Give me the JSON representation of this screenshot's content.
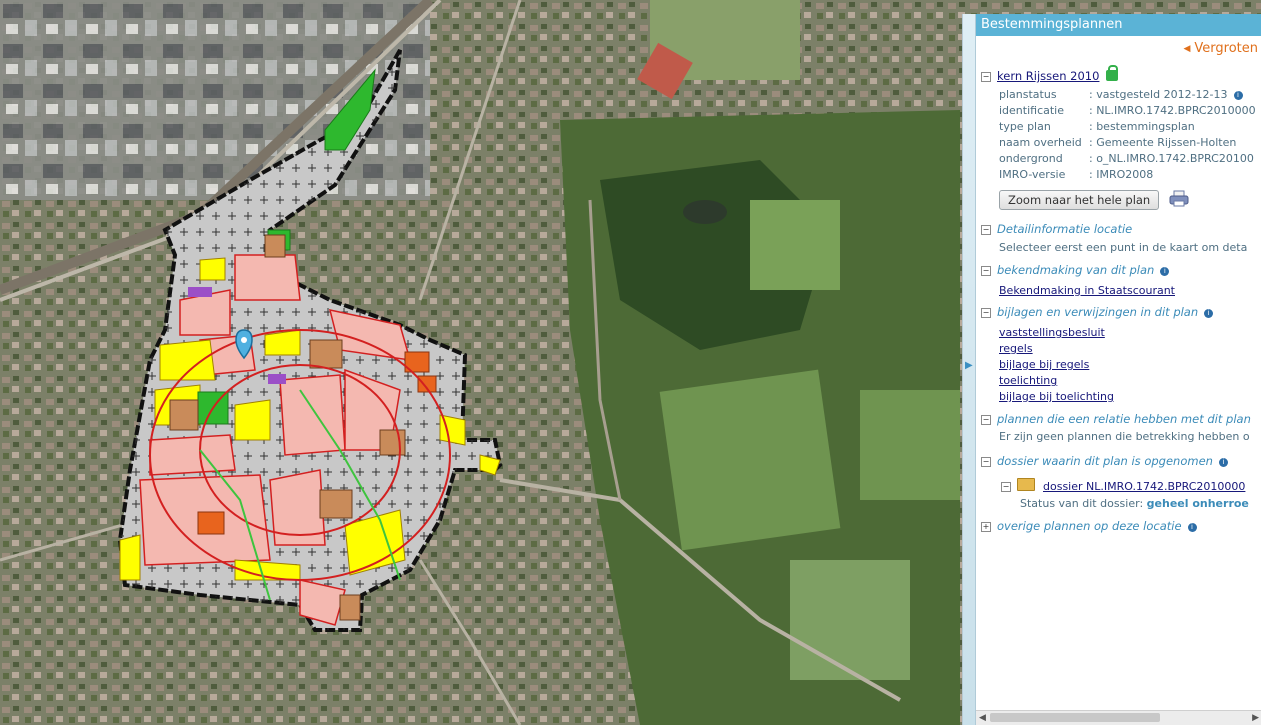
{
  "panel": {
    "title": "Bestemmingsplannen",
    "vergroten_label": "Vergroten",
    "plan": {
      "name": "kern Rijssen 2010",
      "fields": [
        {
          "key": "planstatus",
          "value": ": vastgesteld 2012-12-13"
        },
        {
          "key": "identificatie",
          "value": ": NL.IMRO.1742.BPRC2010000"
        },
        {
          "key": "type plan",
          "value": ": bestemmingsplan"
        },
        {
          "key": "naam overheid",
          "value": ": Gemeente Rijssen-Holten"
        },
        {
          "key": "ondergrond",
          "value": ": o_NL.IMRO.1742.BPRC20100"
        },
        {
          "key": "IMRO-versie",
          "value": ": IMRO2008"
        }
      ],
      "zoom_button": "Zoom naar het hele plan"
    },
    "detail": {
      "title": "Detailinformatie locatie",
      "text": "Selecteer eerst een punt in de kaart om deta"
    },
    "bekendmaking": {
      "title": "bekendmaking van dit plan",
      "link": "Bekendmaking in Staatscourant"
    },
    "bijlagen": {
      "title": "bijlagen en verwijzingen in dit plan",
      "links": [
        "vaststellingsbesluit",
        "regels",
        "bijlage bij regels",
        "toelichting",
        "bijlage bij toelichting"
      ]
    },
    "relaties": {
      "title": "plannen die een relatie hebben met dit plan",
      "text": "Er zijn geen plannen die betrekking hebben o"
    },
    "dossier": {
      "title": "dossier waarin dit plan is opgenomen",
      "link": "dossier NL.IMRO.1742.BPRC2010000",
      "status_label": "Status van dit dossier: ",
      "status_value": "geheel onherroe"
    },
    "overige": {
      "title": "overige plannen op deze locatie"
    },
    "colors": {
      "header": "#5bb3d6",
      "link": "#17187a",
      "section": "#3b8bb8",
      "accent": "#e0701c"
    }
  },
  "map": {
    "legend_colors": {
      "centrum_pink": "#f4b8b0",
      "wonen_yellow": "#ffff00",
      "groen": "#2eb82e",
      "verkeer_grey": "#c8c8c8",
      "maatschappelijk_brown": "#c98b5a",
      "bedrijf_orange": "#e8641e",
      "outline_red": "#d32020"
    }
  }
}
